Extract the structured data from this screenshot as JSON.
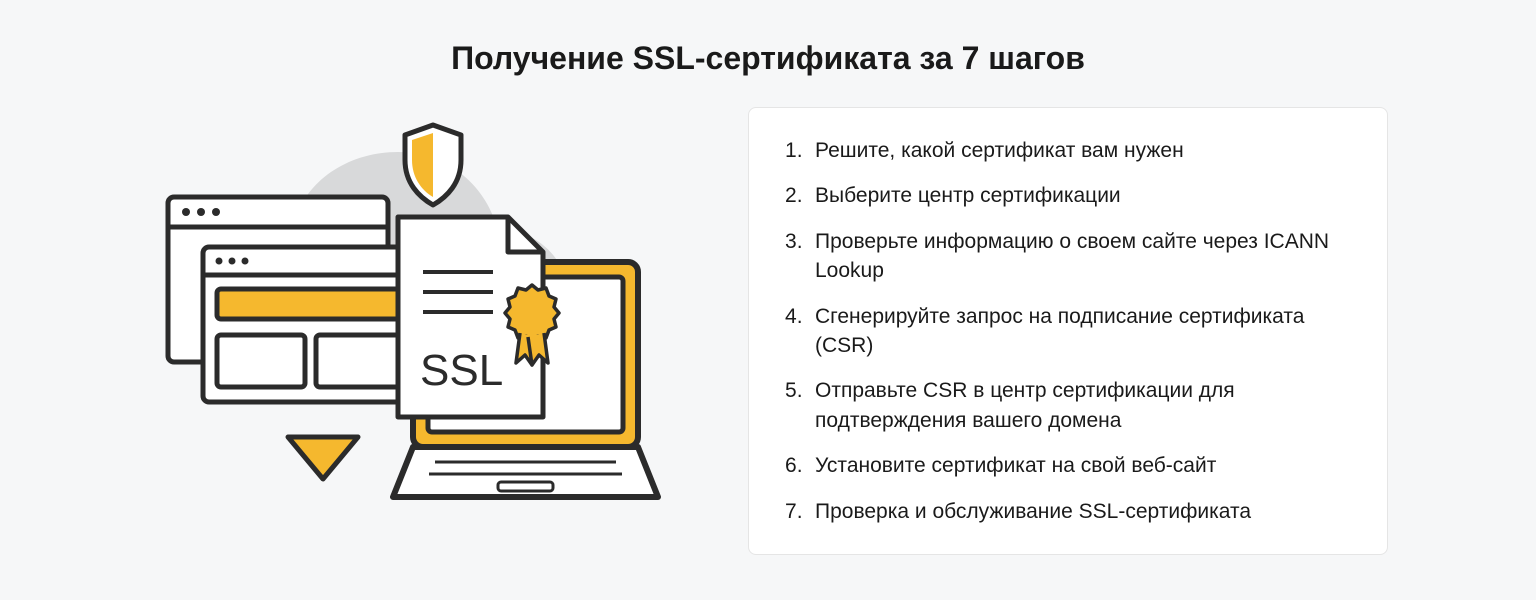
{
  "title": "Получение SSL-сертификата за 7 шагов",
  "illustration": {
    "ssl_label": "SSL"
  },
  "colors": {
    "accent": "#f5b82e",
    "outline": "#2b2b2b",
    "cloud": "#d8d9da",
    "white": "#ffffff",
    "bg": "#f6f7f8"
  },
  "steps": [
    "Решите, какой сертификат вам нужен",
    "Выберите центр сертификации",
    "Проверьте информацию о своем сайте через ICANN Lookup",
    "Сгенерируйте запрос на подписание сертификата (CSR)",
    "Отправьте CSR в центр сертификации для подтверждения вашего домена",
    "Установите сертификат на свой веб-сайт",
    "Проверка и обслуживание SSL-сертификата"
  ]
}
